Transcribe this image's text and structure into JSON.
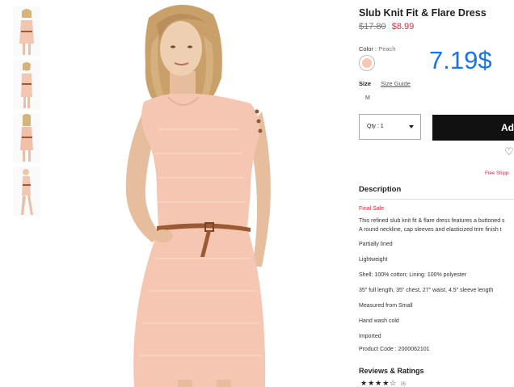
{
  "product": {
    "title": "Slub Knit Fit & Flare Dress",
    "price_original": "$17.80",
    "price_sale": "$8.99",
    "color_label": "Color :",
    "color_value": "Peach",
    "size_label": "Size",
    "size_guide": "Size Guide",
    "size_option": "M",
    "qty_label": "Qty : 1",
    "add_button": "Ad",
    "free_shipping": "Free Shipp",
    "accent_color": "#e0283b"
  },
  "description": {
    "heading": "Description",
    "final_sale": "Final Sale",
    "line1": "This refined slub knit fit & flare dress features a buttoned s",
    "line2": "A round neckline, cap sleeves and elasticized trim finish t",
    "bullets": [
      "Partially lined",
      "Lightweight",
      "Shell: 100% cotton; Lining: 100% polyester",
      "35\" full length, 35\" chest, 27\" waist, 4.5\" sleeve length",
      "Measured from Small",
      "Hand wash cold",
      "Imported"
    ],
    "product_code": "Product Code : 2000062101"
  },
  "reviews": {
    "heading": "Reviews & Ratings",
    "stars": "★★★★☆",
    "count": "35",
    "rating": 3.5
  },
  "overlay": {
    "price_text": "7.19$",
    "color": "#1a73e8"
  },
  "icons": [
    "heart-icon",
    "chevron-down-icon"
  ]
}
